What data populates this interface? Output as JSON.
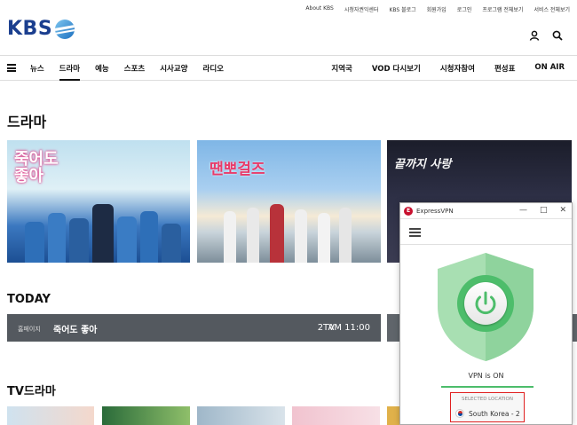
{
  "utility_links": [
    "About KBS",
    "시청자권익센터",
    "KBS 블로그",
    "회원가입",
    "로그인",
    "프로그램 전체보기",
    "서비스 전체보기"
  ],
  "brand": {
    "logo_text": "KBS"
  },
  "nav": {
    "left": [
      "뉴스",
      "드라마",
      "예능",
      "스포츠",
      "시사교양",
      "라디오"
    ],
    "active": "드라마",
    "right": [
      "지역국",
      "VOD 다시보기",
      "시청자참여",
      "편성표",
      "ON AIR"
    ]
  },
  "sections": {
    "drama": "드라마",
    "today": "TODAY",
    "tv_drama": "TV드라마"
  },
  "drama_cards": [
    {
      "title": "죽어도 좋아"
    },
    {
      "title": "땐뽀걸즈"
    },
    {
      "title": "끝까지 사랑"
    }
  ],
  "today": {
    "home_label": "홈페이지",
    "show": "죽어도 좋아",
    "channel": "2TV",
    "time": "AM 11:00"
  },
  "vpn": {
    "app_name": "ExpressVPN",
    "status": "VPN is ON",
    "location_label": "SELECTED LOCATION",
    "location": "South Korea - 2",
    "accent": "#4dbd6b",
    "highlight": "#e02020"
  },
  "colors": {
    "kbs_blue": "#1b3f8f",
    "today_bar": "#54595f"
  }
}
